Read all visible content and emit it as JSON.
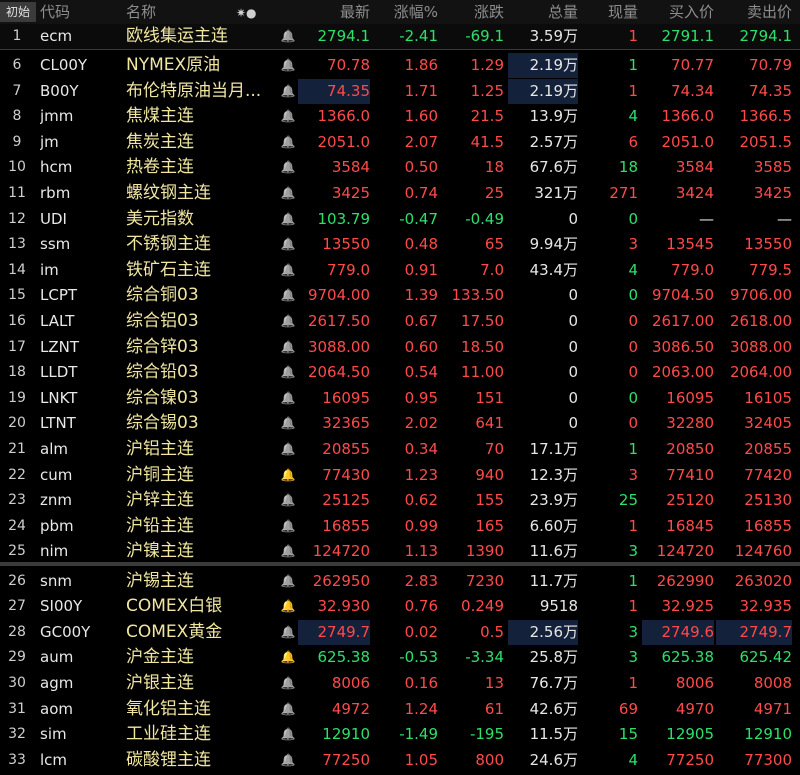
{
  "header": {
    "init_label": "初始",
    "columns": {
      "code": "代码",
      "name": "名称",
      "marker": "✷●",
      "last": "最新",
      "pct": "涨幅%",
      "chg": "涨跌",
      "vol": "总量",
      "cur": "现量",
      "bid": "买入价",
      "ask": "卖出价"
    }
  },
  "rows": [
    {
      "idx": "1",
      "code": "ecm",
      "name": "欧线集运主连",
      "last": "2794.1",
      "pct": "-2.41",
      "chg": "-69.1",
      "vol": "3.59万",
      "cur": "1",
      "bid": "2791.1",
      "ask": "2794.1",
      "dir": "down",
      "cur_dir": "up",
      "bell": "normal"
    },
    {
      "idx": "6",
      "code": "CL00Y",
      "name": "NYMEX原油",
      "last": "70.78",
      "pct": "1.86",
      "chg": "1.29",
      "vol": "2.19万",
      "cur": "1",
      "bid": "70.77",
      "ask": "70.79",
      "dir": "up",
      "cur_dir": "down",
      "bell": "normal"
    },
    {
      "idx": "7",
      "code": "B00Y",
      "name": "布伦特原油当月...",
      "last": "74.35",
      "pct": "1.71",
      "chg": "1.25",
      "vol": "2.19万",
      "cur": "1",
      "bid": "74.34",
      "ask": "74.35",
      "dir": "up",
      "cur_dir": "up",
      "bell": "normal"
    },
    {
      "idx": "8",
      "code": "jmm",
      "name": "焦煤主连",
      "last": "1366.0",
      "pct": "1.60",
      "chg": "21.5",
      "vol": "13.9万",
      "cur": "4",
      "bid": "1366.0",
      "ask": "1366.5",
      "dir": "up",
      "cur_dir": "down",
      "bell": "normal"
    },
    {
      "idx": "9",
      "code": "jm",
      "name": "焦炭主连",
      "last": "2051.0",
      "pct": "2.07",
      "chg": "41.5",
      "vol": "2.57万",
      "cur": "6",
      "bid": "2051.0",
      "ask": "2051.5",
      "dir": "up",
      "cur_dir": "up",
      "bell": "normal"
    },
    {
      "idx": "10",
      "code": "hcm",
      "name": "热卷主连",
      "last": "3584",
      "pct": "0.50",
      "chg": "18",
      "vol": "67.6万",
      "cur": "18",
      "bid": "3584",
      "ask": "3585",
      "dir": "up",
      "cur_dir": "down",
      "bell": "normal"
    },
    {
      "idx": "11",
      "code": "rbm",
      "name": "螺纹钢主连",
      "last": "3425",
      "pct": "0.74",
      "chg": "25",
      "vol": "321万",
      "cur": "271",
      "bid": "3424",
      "ask": "3425",
      "dir": "up",
      "cur_dir": "up",
      "bell": "normal"
    },
    {
      "idx": "12",
      "code": "UDI",
      "name": "美元指数",
      "last": "103.79",
      "pct": "-0.47",
      "chg": "-0.49",
      "vol": "0",
      "cur": "0",
      "bid": "—",
      "ask": "—",
      "dir": "down",
      "cur_dir": "down",
      "bell": "normal"
    },
    {
      "idx": "13",
      "code": "ssm",
      "name": "不锈钢主连",
      "last": "13550",
      "pct": "0.48",
      "chg": "65",
      "vol": "9.94万",
      "cur": "3",
      "bid": "13545",
      "ask": "13550",
      "dir": "up",
      "cur_dir": "up",
      "bell": "normal"
    },
    {
      "idx": "14",
      "code": "im",
      "name": "铁矿石主连",
      "last": "779.0",
      "pct": "0.91",
      "chg": "7.0",
      "vol": "43.4万",
      "cur": "4",
      "bid": "779.0",
      "ask": "779.5",
      "dir": "up",
      "cur_dir": "down",
      "bell": "normal"
    },
    {
      "idx": "15",
      "code": "LCPT",
      "name": "综合铜03",
      "last": "9704.00",
      "pct": "1.39",
      "chg": "133.50",
      "vol": "0",
      "cur": "0",
      "bid": "9704.50",
      "ask": "9706.00",
      "dir": "up",
      "cur_dir": "down",
      "bell": "normal"
    },
    {
      "idx": "16",
      "code": "LALT",
      "name": "综合铝03",
      "last": "2617.50",
      "pct": "0.67",
      "chg": "17.50",
      "vol": "0",
      "cur": "0",
      "bid": "2617.00",
      "ask": "2618.00",
      "dir": "up",
      "cur_dir": "up",
      "bell": "normal"
    },
    {
      "idx": "17",
      "code": "LZNT",
      "name": "综合锌03",
      "last": "3088.00",
      "pct": "0.60",
      "chg": "18.50",
      "vol": "0",
      "cur": "0",
      "bid": "3086.50",
      "ask": "3088.00",
      "dir": "up",
      "cur_dir": "up",
      "bell": "normal"
    },
    {
      "idx": "18",
      "code": "LLDT",
      "name": "综合铅03",
      "last": "2064.50",
      "pct": "0.54",
      "chg": "11.00",
      "vol": "0",
      "cur": "0",
      "bid": "2063.00",
      "ask": "2064.00",
      "dir": "up",
      "cur_dir": "up",
      "bell": "normal"
    },
    {
      "idx": "19",
      "code": "LNKT",
      "name": "综合镍03",
      "last": "16095",
      "pct": "0.95",
      "chg": "151",
      "vol": "0",
      "cur": "0",
      "bid": "16095",
      "ask": "16105",
      "dir": "up",
      "cur_dir": "down",
      "bell": "normal"
    },
    {
      "idx": "20",
      "code": "LTNT",
      "name": "综合锡03",
      "last": "32365",
      "pct": "2.02",
      "chg": "641",
      "vol": "0",
      "cur": "0",
      "bid": "32280",
      "ask": "32405",
      "dir": "up",
      "cur_dir": "up",
      "bell": "normal"
    },
    {
      "idx": "21",
      "code": "alm",
      "name": "沪铝主连",
      "last": "20855",
      "pct": "0.34",
      "chg": "70",
      "vol": "17.1万",
      "cur": "1",
      "bid": "20850",
      "ask": "20855",
      "dir": "up",
      "cur_dir": "down",
      "bell": "normal"
    },
    {
      "idx": "22",
      "code": "cum",
      "name": "沪铜主连",
      "last": "77430",
      "pct": "1.23",
      "chg": "940",
      "vol": "12.3万",
      "cur": "3",
      "bid": "77410",
      "ask": "77420",
      "dir": "up",
      "cur_dir": "up",
      "bell": "active"
    },
    {
      "idx": "23",
      "code": "znm",
      "name": "沪锌主连",
      "last": "25125",
      "pct": "0.62",
      "chg": "155",
      "vol": "23.9万",
      "cur": "25",
      "bid": "25120",
      "ask": "25130",
      "dir": "up",
      "cur_dir": "down",
      "bell": "normal"
    },
    {
      "idx": "24",
      "code": "pbm",
      "name": "沪铅主连",
      "last": "16855",
      "pct": "0.99",
      "chg": "165",
      "vol": "6.60万",
      "cur": "1",
      "bid": "16845",
      "ask": "16855",
      "dir": "up",
      "cur_dir": "up",
      "bell": "normal"
    },
    {
      "idx": "25",
      "code": "nim",
      "name": "沪镍主连",
      "last": "124720",
      "pct": "1.13",
      "chg": "1390",
      "vol": "11.6万",
      "cur": "3",
      "bid": "124720",
      "ask": "124760",
      "dir": "up",
      "cur_dir": "down",
      "bell": "normal"
    },
    {
      "idx": "26",
      "code": "snm",
      "name": "沪锡主连",
      "last": "262950",
      "pct": "2.83",
      "chg": "7230",
      "vol": "11.7万",
      "cur": "1",
      "bid": "262990",
      "ask": "263020",
      "dir": "up",
      "cur_dir": "down",
      "bell": "normal"
    },
    {
      "idx": "27",
      "code": "SI00Y",
      "name": "COMEX白银",
      "last": "32.930",
      "pct": "0.76",
      "chg": "0.249",
      "vol": "9518",
      "cur": "1",
      "bid": "32.925",
      "ask": "32.935",
      "dir": "up",
      "cur_dir": "up",
      "bell": "active"
    },
    {
      "idx": "28",
      "code": "GC00Y",
      "name": "COMEX黄金",
      "last": "2749.7",
      "pct": "0.02",
      "chg": "0.5",
      "vol": "2.56万",
      "cur": "3",
      "bid": "2749.6",
      "ask": "2749.7",
      "dir": "up",
      "cur_dir": "down",
      "bell": "normal"
    },
    {
      "idx": "29",
      "code": "aum",
      "name": "沪金主连",
      "last": "625.38",
      "pct": "-0.53",
      "chg": "-3.34",
      "vol": "25.8万",
      "cur": "3",
      "bid": "625.38",
      "ask": "625.42",
      "dir": "down",
      "cur_dir": "down",
      "bell": "active"
    },
    {
      "idx": "30",
      "code": "agm",
      "name": "沪银主连",
      "last": "8006",
      "pct": "0.16",
      "chg": "13",
      "vol": "76.7万",
      "cur": "1",
      "bid": "8006",
      "ask": "8008",
      "dir": "up",
      "cur_dir": "up",
      "bell": "normal"
    },
    {
      "idx": "31",
      "code": "aom",
      "name": "氧化铝主连",
      "last": "4972",
      "pct": "1.24",
      "chg": "61",
      "vol": "42.6万",
      "cur": "69",
      "bid": "4970",
      "ask": "4971",
      "dir": "up",
      "cur_dir": "up",
      "bell": "normal"
    },
    {
      "idx": "32",
      "code": "sim",
      "name": "工业硅主连",
      "last": "12910",
      "pct": "-1.49",
      "chg": "-195",
      "vol": "11.5万",
      "cur": "15",
      "bid": "12905",
      "ask": "12910",
      "dir": "down",
      "cur_dir": "down",
      "bell": "normal"
    },
    {
      "idx": "33",
      "code": "lcm",
      "name": "碳酸锂主连",
      "last": "77250",
      "pct": "1.05",
      "chg": "800",
      "vol": "24.6万",
      "cur": "4",
      "bid": "77250",
      "ask": "77300",
      "dir": "up",
      "cur_dir": "down",
      "bell": "normal"
    }
  ]
}
